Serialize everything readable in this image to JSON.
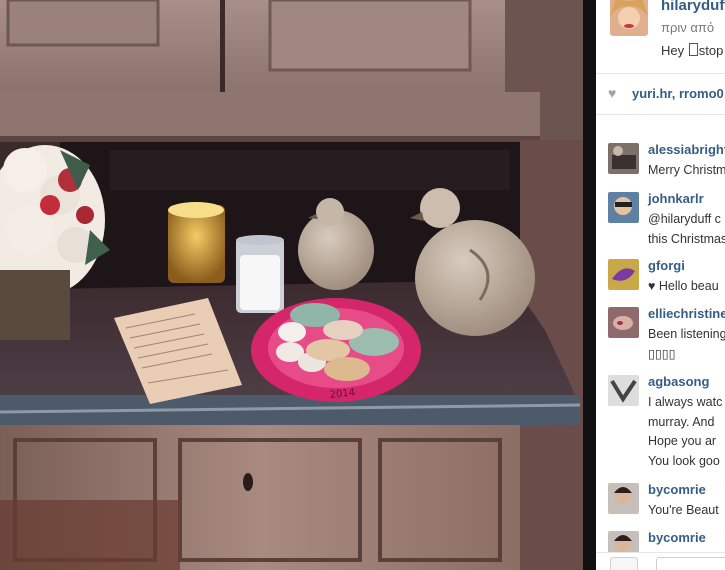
{
  "post": {
    "username": "hilaryduff",
    "time_ago": "πριν από",
    "caption": "Hey",
    "caption_after": "stop",
    "likes_names": "yuri.hr, rromo0"
  },
  "photo": {
    "plate_text": "2014"
  },
  "comments": [
    {
      "user": "alessiabright",
      "text": "Merry Christmas"
    },
    {
      "user": "johnkarlr",
      "text": "@hilaryduff c\nthis Christmas"
    },
    {
      "user": "gforgi",
      "text": "♥ Hello beau"
    },
    {
      "user": "elliechristine",
      "text": "Been listening\n▯▯▯▯"
    },
    {
      "user": "agbasong",
      "text": "I always watc\nmurray. And\nHope you ar\nYou look goo"
    },
    {
      "user": "bycomrie",
      "text": "You're Beaut"
    },
    {
      "user": "bycomrie",
      "text": ""
    }
  ],
  "colors": {
    "link": "#355d87",
    "plate": "#d6266b",
    "background_dark": "#2a1d1c"
  }
}
